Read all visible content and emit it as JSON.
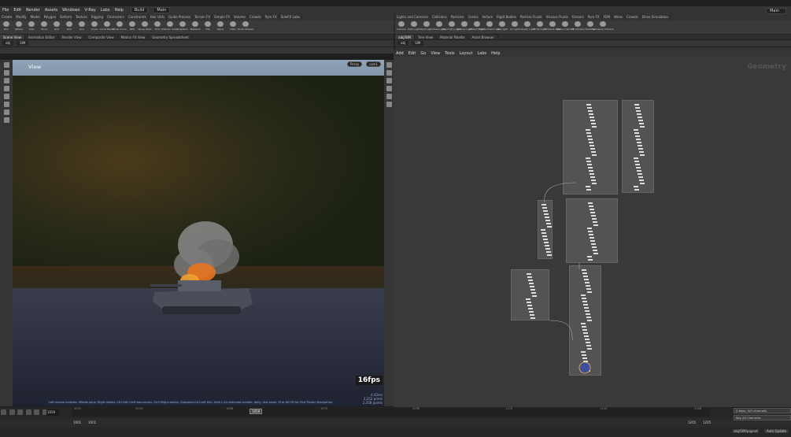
{
  "menubar": {
    "items": [
      "File",
      "Edit",
      "Render",
      "Assets",
      "Windows",
      "V-Ray",
      "Labs",
      "Help"
    ],
    "build": "Build",
    "main": "Main",
    "desktop": "Main"
  },
  "shelf_left": {
    "tabs": [
      "Create",
      "Modify",
      "Model",
      "Polygon",
      "Deform",
      "Texture",
      "Rigging",
      "Characters",
      "Constraints",
      "Hair Utils",
      "Guide Process",
      "Terrain FX",
      "Simple FX",
      "Volume",
      "Crowds",
      "Pyro FX",
      "SideFX Labs"
    ],
    "tools": [
      "Box",
      "Sphere",
      "Tube",
      "Torus",
      "Grid",
      "Null",
      "Line",
      "Circle",
      "Curve Bezier",
      "Draw Curve",
      "Path",
      "Spray Paint",
      "Font",
      "Platonic Solids",
      "L-System",
      "Metaball",
      "File",
      "Spiral",
      "Helix",
      "Quick Shapes"
    ]
  },
  "shelf_right": {
    "tabs": [
      "Lights and Cameras",
      "Collisions",
      "Particles",
      "Grains",
      "Vellum",
      "Rigid Bodies",
      "Particle Fluids",
      "Viscous Fluids",
      "Oceans",
      "Pyro FX",
      "FEM",
      "Wires",
      "Crowds",
      "Drive Simulation"
    ],
    "tools": [
      "Camera",
      "Point Light",
      "Spot Light",
      "Area Light",
      "Geometry Light",
      "Volume Light",
      "Distant Light",
      "Environment Light",
      "Sky Light",
      "GI Light",
      "Caustic Light",
      "Portal Light",
      "Ambient Light",
      "Stereo Camera",
      "VR Camera",
      "Switcher",
      "Gamepad Camera"
    ]
  },
  "left_pane": {
    "tabs": [
      "Scene View",
      "Animation Editor",
      "Render View",
      "Composite View",
      "Motion FX View",
      "Geometry Spreadsheet"
    ],
    "path": [
      "obj",
      "SIM"
    ],
    "view_label": "View",
    "persp": "Persp",
    "cam": "cam1",
    "fps": "16fps",
    "stats": [
      "4.42ms",
      "2,252 prims",
      "2,358 points"
    ],
    "hint": "Left mouse tumbles. Middle pans. Right dollies. Ctrl+Alt+Left box-zooms. Ctrl+Right zooms. Spacebar-Ctrl-Left tilts. Hold L for alternate tumble, dolly, and zoom. M or Alt+M for First Person Navigation."
  },
  "right_pane": {
    "tabs": [
      "/obj/SIM",
      "Tree View",
      "Material Palette",
      "Asset Browser"
    ],
    "path": [
      "obj",
      "SIM"
    ],
    "menu": [
      "Add",
      "Edit",
      "Go",
      "View",
      "Tools",
      "Layout",
      "Labs",
      "Help"
    ],
    "context_label": "Geometry"
  },
  "timeline": {
    "current_frame": "1059",
    "frame_field": "1059",
    "ticks": [
      "1001",
      "1024",
      "1048",
      "1072",
      "1096",
      "1120",
      "1144",
      "1168",
      "1192"
    ],
    "range_start": "1001",
    "range_start2": "1001",
    "range_end": "1205",
    "range_end2": "1205",
    "channels_label": "0 keys, 0/0 channels",
    "key_all": "Key All Channels"
  },
  "status": {
    "path": "/obj/SIM/popnet",
    "auto_update": "Auto Update"
  },
  "colors": {
    "accent": "#e2a03b",
    "bg": "#2a2a2a"
  }
}
